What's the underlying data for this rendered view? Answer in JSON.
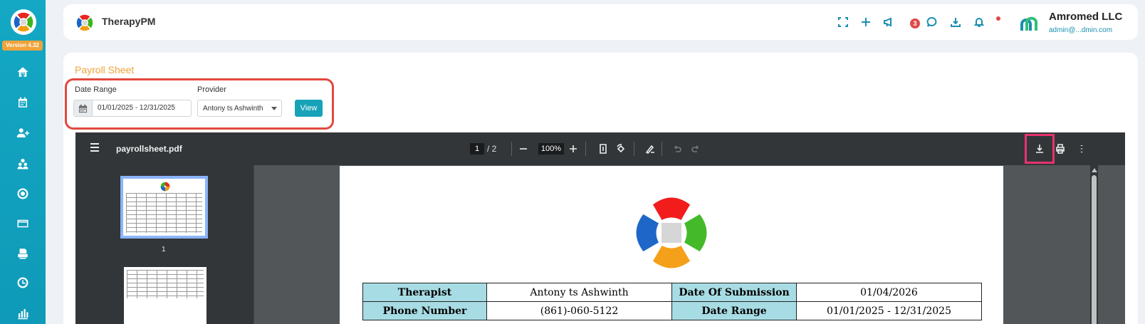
{
  "sidebar": {
    "version": "Version 4.32",
    "items": [
      "home-icon",
      "calendar-icon",
      "user-plus-icon",
      "users-icon",
      "target-icon",
      "card-icon",
      "printer-icon",
      "clock-icon",
      "chart-icon"
    ]
  },
  "header": {
    "brand": "TherapyPM",
    "notification_count": "3",
    "user_name": "Amromed LLC",
    "user_email": "admin@...dmin.com"
  },
  "main": {
    "page_title": "Payroll Sheet",
    "date_range_label": "Date Range",
    "date_range_value": "01/01/2025 - 12/31/2025",
    "provider_label": "Provider",
    "provider_value": "Antony ts Ashwinth",
    "view_button": "View"
  },
  "pdf": {
    "filename": "payrollsheet.pdf",
    "current_page": "1",
    "total_pages": "/ 2",
    "zoom": "100%",
    "thumb1_label": "1",
    "table": [
      [
        "Therapist",
        "Antony ts Ashwinth",
        "Date Of Submission",
        "01/04/2026"
      ],
      [
        "Phone Number",
        "(861)-060-5122",
        "Date Range",
        "01/01/2025 - 12/31/2025"
      ]
    ]
  },
  "colors": {
    "accent": "#17a2b8",
    "title": "#f0a33a",
    "highlight": "#e3483f",
    "header_cell": "#a8dce4"
  }
}
